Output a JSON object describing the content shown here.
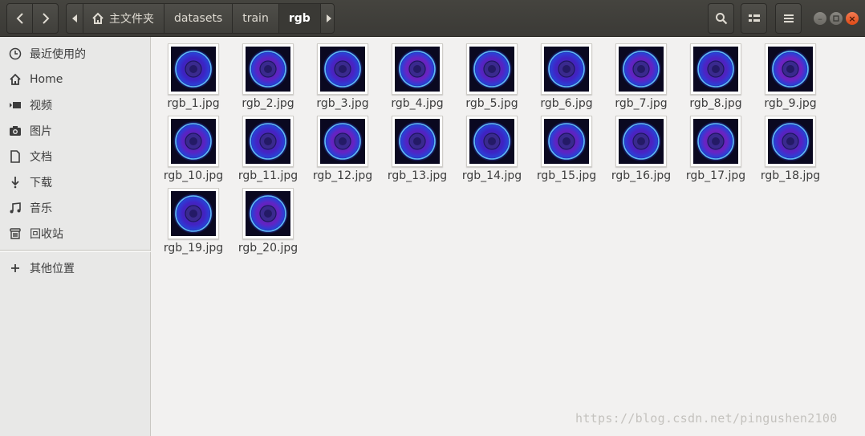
{
  "header": {
    "breadcrumbs": [
      "主文件夹",
      "datasets",
      "train",
      "rgb"
    ]
  },
  "sidebar": {
    "items": [
      {
        "label": "最近使用的",
        "icon": "clock-icon"
      },
      {
        "label": "Home",
        "icon": "home-icon"
      },
      {
        "label": "视频",
        "icon": "video-icon"
      },
      {
        "label": "图片",
        "icon": "camera-icon"
      },
      {
        "label": "文档",
        "icon": "document-icon"
      },
      {
        "label": "下载",
        "icon": "download-icon"
      },
      {
        "label": "音乐",
        "icon": "music-icon"
      },
      {
        "label": "回收站",
        "icon": "trash-icon"
      }
    ],
    "other": {
      "label": "其他位置",
      "icon": "plus-icon"
    }
  },
  "files": [
    "rgb_1.jpg",
    "rgb_2.jpg",
    "rgb_3.jpg",
    "rgb_4.jpg",
    "rgb_5.jpg",
    "rgb_6.jpg",
    "rgb_7.jpg",
    "rgb_8.jpg",
    "rgb_9.jpg",
    "rgb_10.jpg",
    "rgb_11.jpg",
    "rgb_12.jpg",
    "rgb_13.jpg",
    "rgb_14.jpg",
    "rgb_15.jpg",
    "rgb_16.jpg",
    "rgb_17.jpg",
    "rgb_18.jpg",
    "rgb_19.jpg",
    "rgb_20.jpg"
  ],
  "watermark": "https://blog.csdn.net/pingushen2100",
  "colors": {
    "header_bg": "#3c3b37",
    "sidebar_bg": "#e8e8e7",
    "content_bg": "#f2f1f0",
    "close_button": "#e95420"
  }
}
